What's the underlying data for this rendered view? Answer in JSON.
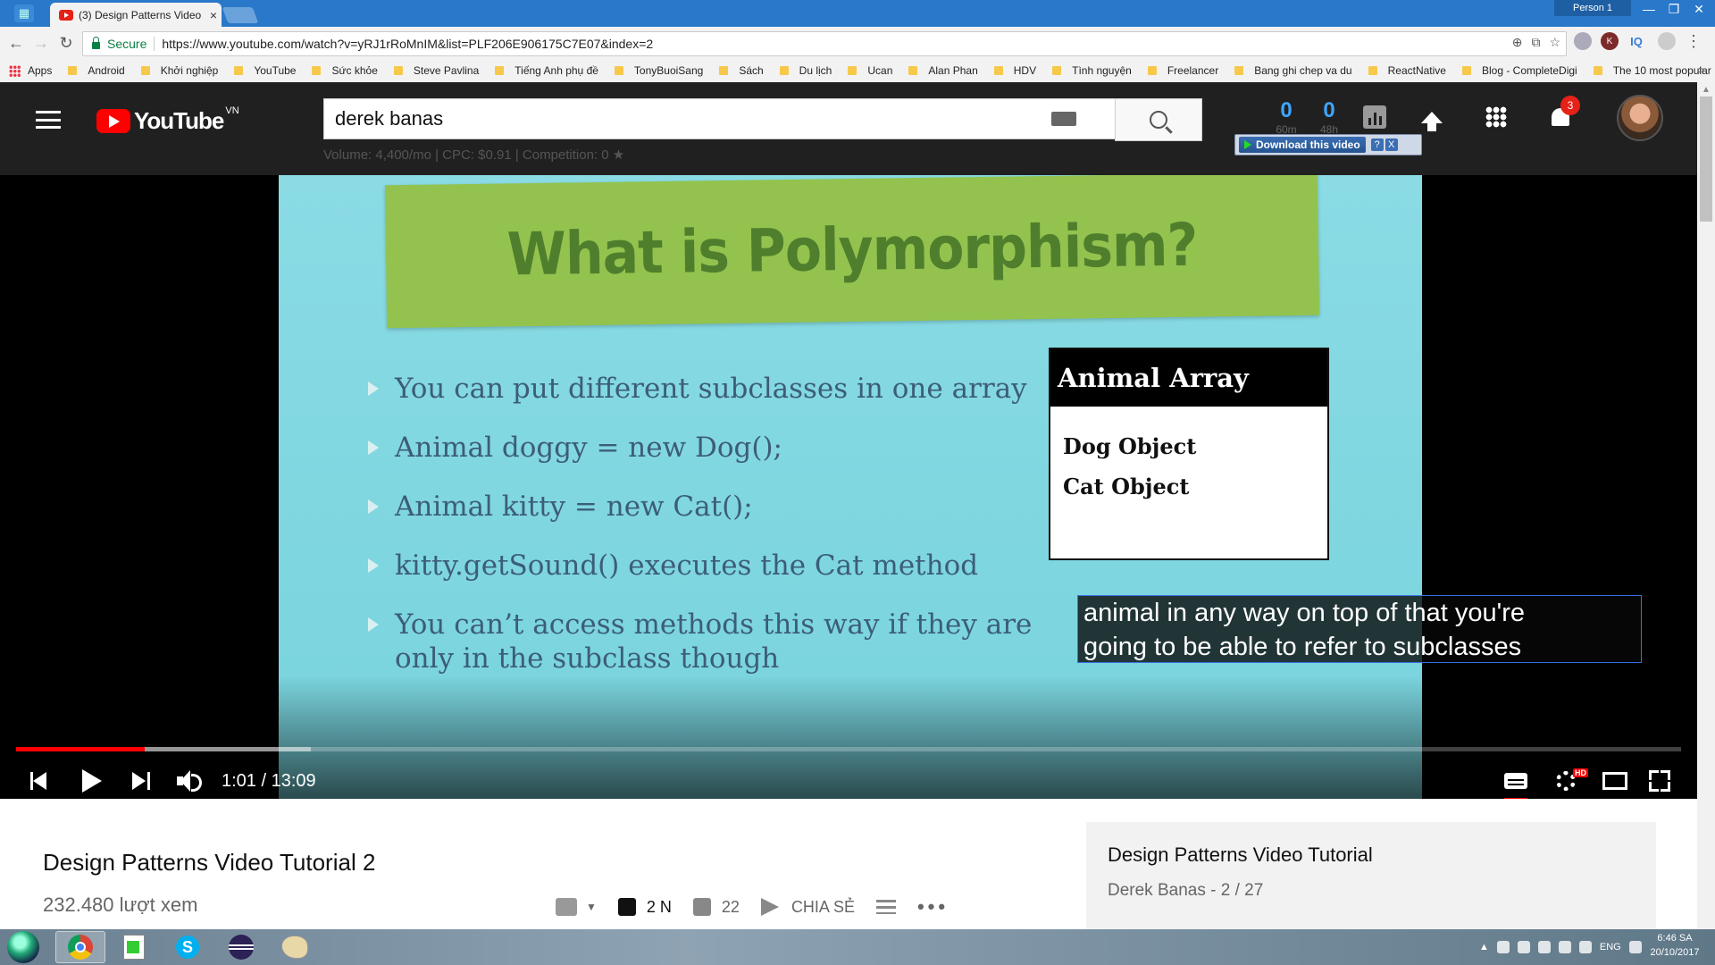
{
  "browser": {
    "tab_title": "(3) Design Patterns Video",
    "tab_close": "×",
    "person": "Person 1",
    "window_buttons": [
      "—",
      "❐",
      "✕"
    ],
    "secure_label": "Secure",
    "url": "https://www.youtube.com/watch?v=yRJ1rRoMnIM&list=PLF206E906175C7E07&index=2",
    "ext_iq": "IQ"
  },
  "bookmarks": [
    "Apps",
    "Android",
    "Khởi nghiệp",
    "YouTube",
    "Sức khỏe",
    "Steve Pavlina",
    "Tiếng Anh phụ đề",
    "TonyBuoiSang",
    "Sách",
    "Du lịch",
    "Ucan",
    "Alan Phan",
    "HDV",
    "Tình nguyện",
    "Freelancer",
    "Bang ghi chep va du",
    "ReactNative",
    "Blog - CompleteDigi",
    "The 10 most popular"
  ],
  "bookmarks_more": "»",
  "youtube": {
    "logo_word": "YouTube",
    "region": "VN",
    "search_value": "derek banas",
    "keyword_stats": "Volume: 4,400/mo | CPC: $0.91 | Competition: 0 ★",
    "counter_left": "0",
    "counter_left_sub": "60m",
    "counter_right": "0",
    "counter_right_sub": "48h",
    "notification_count": "3",
    "download_label": "Download this video",
    "download_help": "?",
    "download_close": "X"
  },
  "slide": {
    "title": "What is Polymorphism?",
    "bullets": [
      "You can put different subclasses in one array",
      "Animal doggy = new Dog();",
      "Animal kitty = new Cat();",
      "kitty.getSound() executes the Cat method",
      "You can’t access methods this way if they are only in the subclass though"
    ],
    "array_title": "Animal Array",
    "array_items": [
      "Dog Object",
      "Cat Object"
    ]
  },
  "caption": {
    "line1": "animal in any way on top of that you're",
    "line2": "going to be able to refer to subclasses"
  },
  "player": {
    "current_time": "1:01",
    "duration": "13:09",
    "time_display": "1:01 / 13:09",
    "played_fraction": 0.077,
    "buffered_fraction": 0.177,
    "quality_badge": "HD"
  },
  "video": {
    "title": "Design Patterns Video Tutorial 2",
    "views": "232.480 lượt xem",
    "likes": "2 N",
    "dislikes": "22",
    "share_label": "CHIA SẺ",
    "more": "•••"
  },
  "playlist": {
    "title": "Design Patterns Video Tutorial",
    "subtitle": "Derek Banas - 2 / 27"
  },
  "taskbar": {
    "language": "ENG",
    "time": "6:46 SA",
    "date": "20/10/2017"
  },
  "colors": {
    "youtube_red": "#ff0000",
    "header_bg": "#202020",
    "slide_bg": "#7ed6df",
    "banner_green": "#93c34e"
  }
}
